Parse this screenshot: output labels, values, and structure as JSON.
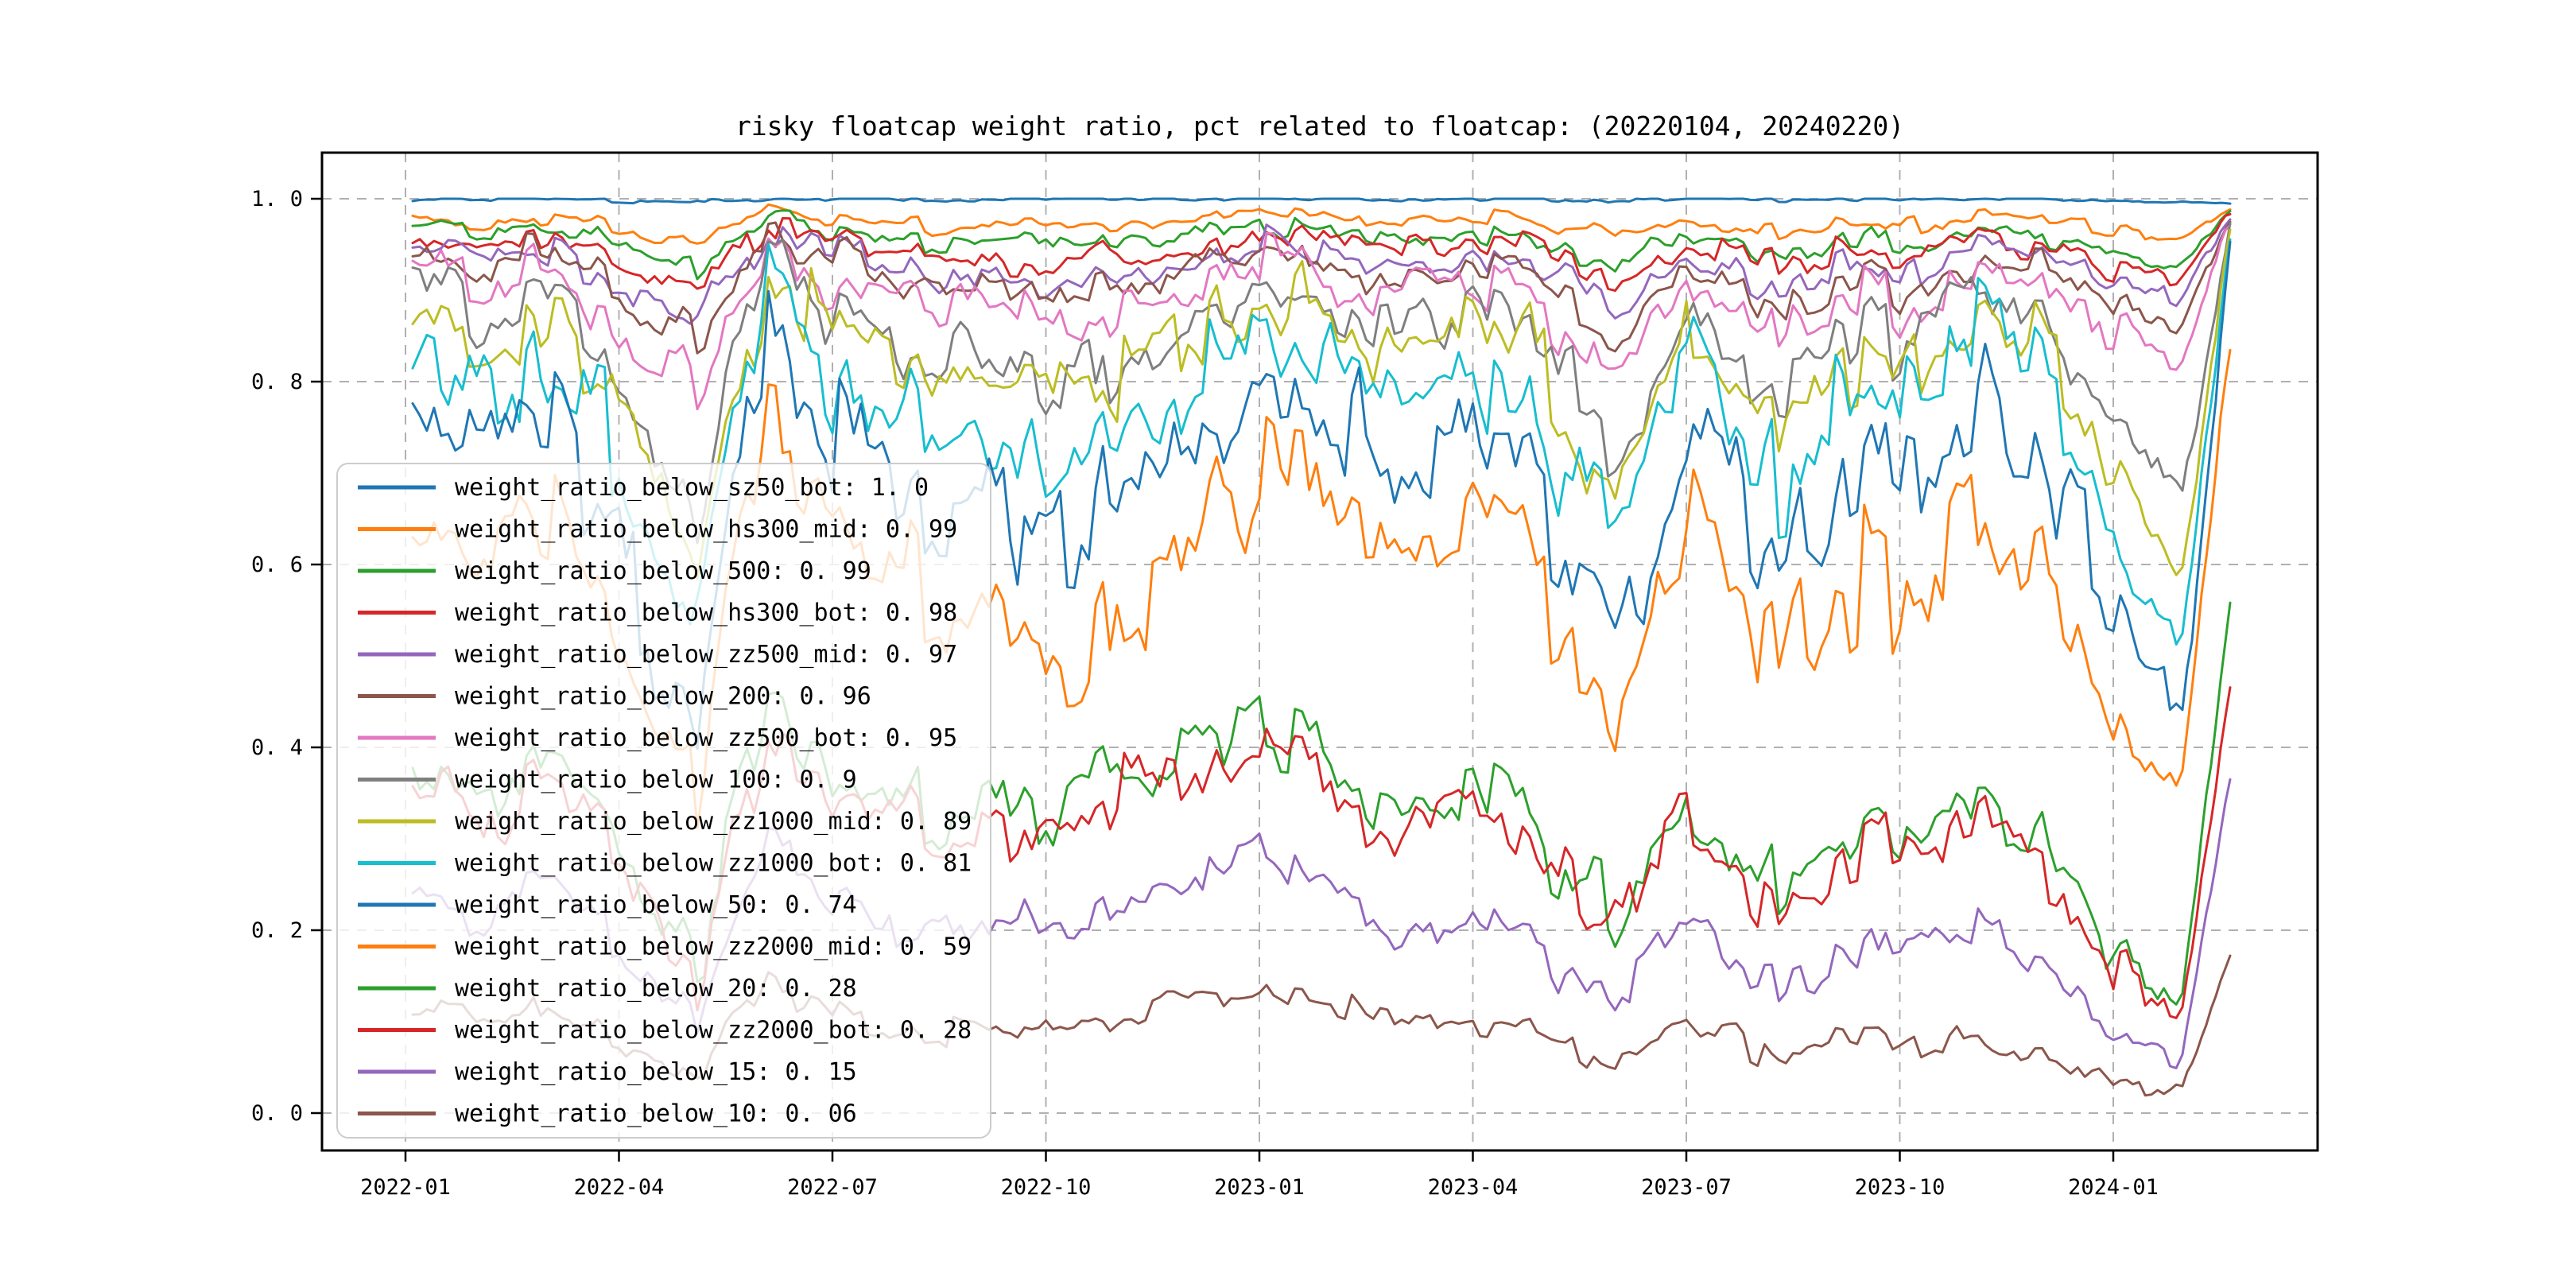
{
  "title": "risky floatcap weight ratio, pct related to floatcap: (20220104, 20240220)",
  "chart_data": {
    "type": "line",
    "title": "risky floatcap weight ratio, pct related to floatcap: (20220104, 20240220)",
    "date_range": [
      "20220104",
      "20240220"
    ],
    "xlabel": "",
    "ylabel": "",
    "ylim": [
      -0.046,
      1.05
    ],
    "grid": true,
    "grid_style": "dashed",
    "legend_position": "lower left",
    "x_tick_labels": [
      "2022-01",
      "2022-04",
      "2022-07",
      "2022-10",
      "2023-01",
      "2023-04",
      "2023-07",
      "2023-10",
      "2024-01"
    ],
    "x_ticks": [
      {
        "label": "2022-01",
        "month": 0
      },
      {
        "label": "2022-04",
        "month": 3
      },
      {
        "label": "2022-07",
        "month": 6
      },
      {
        "label": "2022-10",
        "month": 9
      },
      {
        "label": "2023-01",
        "month": 12
      },
      {
        "label": "2023-04",
        "month": 15
      },
      {
        "label": "2023-07",
        "month": 18
      },
      {
        "label": "2023-10",
        "month": 21
      },
      {
        "label": "2024-01",
        "month": 24
      }
    ],
    "y_ticks": [
      {
        "label": "0. 0",
        "value": 0.0
      },
      {
        "label": "0. 2",
        "value": 0.2
      },
      {
        "label": "0. 4",
        "value": 0.4
      },
      {
        "label": "0. 6",
        "value": 0.6
      },
      {
        "label": "0. 8",
        "value": 0.8
      },
      {
        "label": "1. 0",
        "value": 1.0
      }
    ],
    "x_anchor_dates": [
      "2022-01",
      "2022-02",
      "2022-03",
      "2022-04",
      "2022-05",
      "2022-06",
      "2022-07",
      "2022-08",
      "2022-09",
      "2022-10",
      "2022-11",
      "2022-12",
      "2023-01",
      "2023-02",
      "2023-03",
      "2023-04",
      "2023-05",
      "2023-06",
      "2023-07",
      "2023-08",
      "2023-09",
      "2023-10",
      "2023-11",
      "2023-12",
      "2024-01",
      "2024-02-05",
      "2024-02-20"
    ],
    "series": [
      {
        "name": "weight_ratio_below_sz50_bot",
        "color": "#1f77b4",
        "value": 1.0,
        "display_value": "1. 0",
        "noise": 0.0015,
        "values": [
          1,
          1,
          1,
          0.998,
          0.997,
          1,
          1,
          1,
          0.999,
          0.998,
          1,
          1,
          1,
          1,
          0.999,
          1,
          0.999,
          0.998,
          1,
          0.999,
          1,
          1,
          1,
          1,
          0.998,
          0.997,
          0.995
        ]
      },
      {
        "name": "weight_ratio_below_hs300_mid",
        "color": "#ff7f0e",
        "value": 0.99,
        "display_value": "0. 99",
        "noise": 0.006,
        "values": [
          0.98,
          0.972,
          0.98,
          0.968,
          0.952,
          0.99,
          0.978,
          0.972,
          0.97,
          0.962,
          0.972,
          0.978,
          0.982,
          0.978,
          0.972,
          0.978,
          0.97,
          0.958,
          0.972,
          0.962,
          0.97,
          0.972,
          0.978,
          0.978,
          0.968,
          0.958,
          0.99
        ]
      },
      {
        "name": "weight_ratio_below_500",
        "color": "#2ca02c",
        "value": 0.99,
        "display_value": "0. 99",
        "noise": 0.009,
        "values": [
          0.97,
          0.962,
          0.972,
          0.95,
          0.928,
          0.982,
          0.962,
          0.952,
          0.95,
          0.94,
          0.952,
          0.962,
          0.97,
          0.962,
          0.958,
          0.962,
          0.95,
          0.932,
          0.96,
          0.94,
          0.95,
          0.952,
          0.96,
          0.958,
          0.94,
          0.93,
          0.988
        ]
      },
      {
        "name": "weight_ratio_below_hs300_bot",
        "color": "#d62728",
        "value": 0.98,
        "display_value": "0. 98",
        "noise": 0.011,
        "values": [
          0.958,
          0.948,
          0.958,
          0.93,
          0.908,
          0.972,
          0.95,
          0.94,
          0.932,
          0.92,
          0.94,
          0.95,
          0.958,
          0.95,
          0.948,
          0.95,
          0.938,
          0.91,
          0.948,
          0.922,
          0.938,
          0.94,
          0.95,
          0.948,
          0.928,
          0.918,
          0.985
        ]
      },
      {
        "name": "weight_ratio_below_zz500_mid",
        "color": "#9467bd",
        "value": 0.97,
        "display_value": "0. 97",
        "noise": 0.013,
        "values": [
          0.948,
          0.938,
          0.948,
          0.91,
          0.878,
          0.962,
          0.938,
          0.92,
          0.912,
          0.898,
          0.92,
          0.938,
          0.948,
          0.938,
          0.932,
          0.938,
          0.92,
          0.878,
          0.938,
          0.9,
          0.92,
          0.92,
          0.938,
          0.938,
          0.908,
          0.898,
          0.98
        ]
      },
      {
        "name": "weight_ratio_below_200",
        "color": "#8c564b",
        "value": 0.96,
        "display_value": "0. 96",
        "noise": 0.015,
        "values": [
          0.94,
          0.928,
          0.94,
          0.898,
          0.852,
          0.955,
          0.928,
          0.908,
          0.898,
          0.878,
          0.908,
          0.928,
          0.94,
          0.928,
          0.92,
          0.928,
          0.898,
          0.85,
          0.928,
          0.878,
          0.898,
          0.908,
          0.928,
          0.928,
          0.888,
          0.868,
          0.978
        ]
      },
      {
        "name": "weight_ratio_below_zz500_bot",
        "color": "#e377c2",
        "value": 0.95,
        "display_value": "0. 95",
        "noise": 0.02,
        "values": [
          0.928,
          0.908,
          0.928,
          0.868,
          0.798,
          0.945,
          0.908,
          0.888,
          0.878,
          0.848,
          0.888,
          0.908,
          0.928,
          0.908,
          0.898,
          0.908,
          0.878,
          0.808,
          0.908,
          0.848,
          0.878,
          0.888,
          0.908,
          0.908,
          0.858,
          0.828,
          0.975
        ]
      },
      {
        "name": "weight_ratio_below_100",
        "color": "#7f7f7f",
        "value": 0.9,
        "display_value": "0. 9",
        "noise": 0.028,
        "values": [
          0.898,
          0.868,
          0.898,
          0.818,
          0.668,
          0.928,
          0.868,
          0.838,
          0.828,
          0.778,
          0.838,
          0.868,
          0.898,
          0.878,
          0.858,
          0.878,
          0.828,
          0.718,
          0.878,
          0.778,
          0.828,
          0.848,
          0.878,
          0.868,
          0.758,
          0.678,
          0.97
        ]
      },
      {
        "name": "weight_ratio_below_zz1000_mid",
        "color": "#bcbd22",
        "value": 0.89,
        "display_value": "0. 89",
        "noise": 0.032,
        "values": [
          0.878,
          0.848,
          0.878,
          0.788,
          0.628,
          0.918,
          0.848,
          0.818,
          0.808,
          0.748,
          0.818,
          0.848,
          0.888,
          0.858,
          0.838,
          0.858,
          0.798,
          0.678,
          0.858,
          0.748,
          0.798,
          0.828,
          0.858,
          0.848,
          0.698,
          0.598,
          0.965
        ]
      },
      {
        "name": "weight_ratio_below_zz1000_bot",
        "color": "#17becf",
        "value": 0.81,
        "display_value": "0. 81",
        "noise": 0.042,
        "values": [
          0.838,
          0.798,
          0.838,
          0.718,
          0.548,
          0.908,
          0.798,
          0.768,
          0.758,
          0.678,
          0.758,
          0.798,
          0.848,
          0.818,
          0.788,
          0.818,
          0.748,
          0.618,
          0.818,
          0.678,
          0.748,
          0.778,
          0.818,
          0.798,
          0.618,
          0.518,
          0.965
        ]
      },
      {
        "name": "weight_ratio_below_50",
        "color": "#1f77b4",
        "value": 0.74,
        "display_value": "0. 74",
        "noise": 0.048,
        "values": [
          0.778,
          0.718,
          0.778,
          0.628,
          0.458,
          0.878,
          0.718,
          0.678,
          0.668,
          0.578,
          0.678,
          0.718,
          0.788,
          0.748,
          0.708,
          0.748,
          0.658,
          0.518,
          0.748,
          0.578,
          0.658,
          0.708,
          0.748,
          0.718,
          0.548,
          0.438,
          0.955
        ]
      },
      {
        "name": "weight_ratio_below_zz2000_mid",
        "color": "#ff7f0e",
        "value": 0.59,
        "display_value": "0. 59",
        "noise": 0.042,
        "values": [
          0.678,
          0.618,
          0.678,
          0.518,
          0.358,
          0.768,
          0.618,
          0.568,
          0.558,
          0.438,
          0.558,
          0.618,
          0.698,
          0.648,
          0.598,
          0.648,
          0.548,
          0.438,
          0.648,
          0.468,
          0.548,
          0.598,
          0.638,
          0.578,
          0.418,
          0.378,
          0.84
        ]
      },
      {
        "name": "weight_ratio_below_20",
        "color": "#2ca02c",
        "value": 0.28,
        "display_value": "0. 28",
        "noise": 0.027,
        "values": [
          0.4,
          0.35,
          0.42,
          0.3,
          0.18,
          0.46,
          0.36,
          0.33,
          0.34,
          0.3,
          0.38,
          0.4,
          0.42,
          0.38,
          0.33,
          0.36,
          0.28,
          0.22,
          0.33,
          0.23,
          0.28,
          0.32,
          0.33,
          0.28,
          0.17,
          0.13,
          0.56
        ]
      },
      {
        "name": "weight_ratio_below_zz2000_bot",
        "color": "#d62728",
        "value": 0.28,
        "display_value": "0. 28",
        "noise": 0.027,
        "values": [
          0.37,
          0.32,
          0.39,
          0.27,
          0.16,
          0.43,
          0.33,
          0.31,
          0.32,
          0.28,
          0.36,
          0.38,
          0.4,
          0.36,
          0.31,
          0.34,
          0.27,
          0.21,
          0.32,
          0.22,
          0.27,
          0.31,
          0.32,
          0.27,
          0.16,
          0.12,
          0.47
        ]
      },
      {
        "name": "weight_ratio_below_15",
        "color": "#9467bd",
        "value": 0.15,
        "display_value": "0. 15",
        "noise": 0.018,
        "values": [
          0.25,
          0.21,
          0.26,
          0.17,
          0.1,
          0.3,
          0.22,
          0.2,
          0.21,
          0.18,
          0.24,
          0.26,
          0.28,
          0.24,
          0.2,
          0.22,
          0.17,
          0.13,
          0.2,
          0.14,
          0.17,
          0.19,
          0.2,
          0.16,
          0.09,
          0.07,
          0.37
        ]
      },
      {
        "name": "weight_ratio_below_10",
        "color": "#8c564b",
        "value": 0.06,
        "display_value": "0. 06",
        "noise": 0.011,
        "values": [
          0.12,
          0.1,
          0.12,
          0.08,
          0.05,
          0.15,
          0.1,
          0.09,
          0.1,
          0.08,
          0.11,
          0.13,
          0.14,
          0.12,
          0.09,
          0.1,
          0.08,
          0.06,
          0.09,
          0.065,
          0.07,
          0.08,
          0.08,
          0.06,
          0.035,
          0.03,
          0.17
        ]
      }
    ]
  }
}
